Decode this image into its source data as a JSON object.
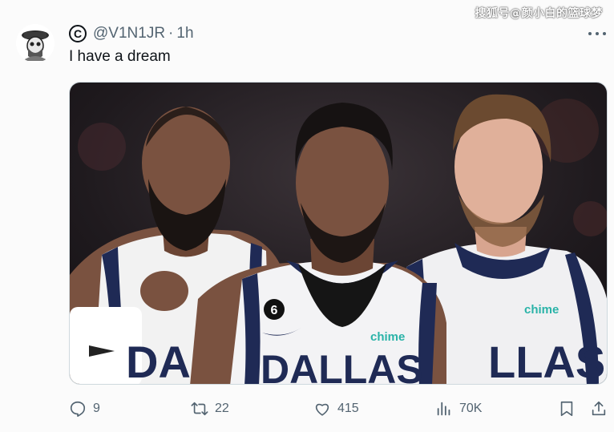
{
  "watermark": "搜狐号@颜小白的篮球梦",
  "tweet": {
    "handle": "@V1N1JR",
    "separator": "·",
    "time": "1h",
    "text": "I have a dream",
    "verified_symbol": "C"
  },
  "image": {
    "jersey_left": "DAL",
    "jersey_center": "DALLAS",
    "jersey_right": "LLAS",
    "jersey_number": "6",
    "sponsor_center": "chime",
    "sponsor_right": "chime"
  },
  "actions": {
    "replies": "9",
    "retweets": "22",
    "likes": "415",
    "views": "70K"
  },
  "colors": {
    "secondary_text": "#536471",
    "primary_text": "#0f1419",
    "dallas_navy": "#1f2a55",
    "chime_teal": "#2ab3a8"
  }
}
